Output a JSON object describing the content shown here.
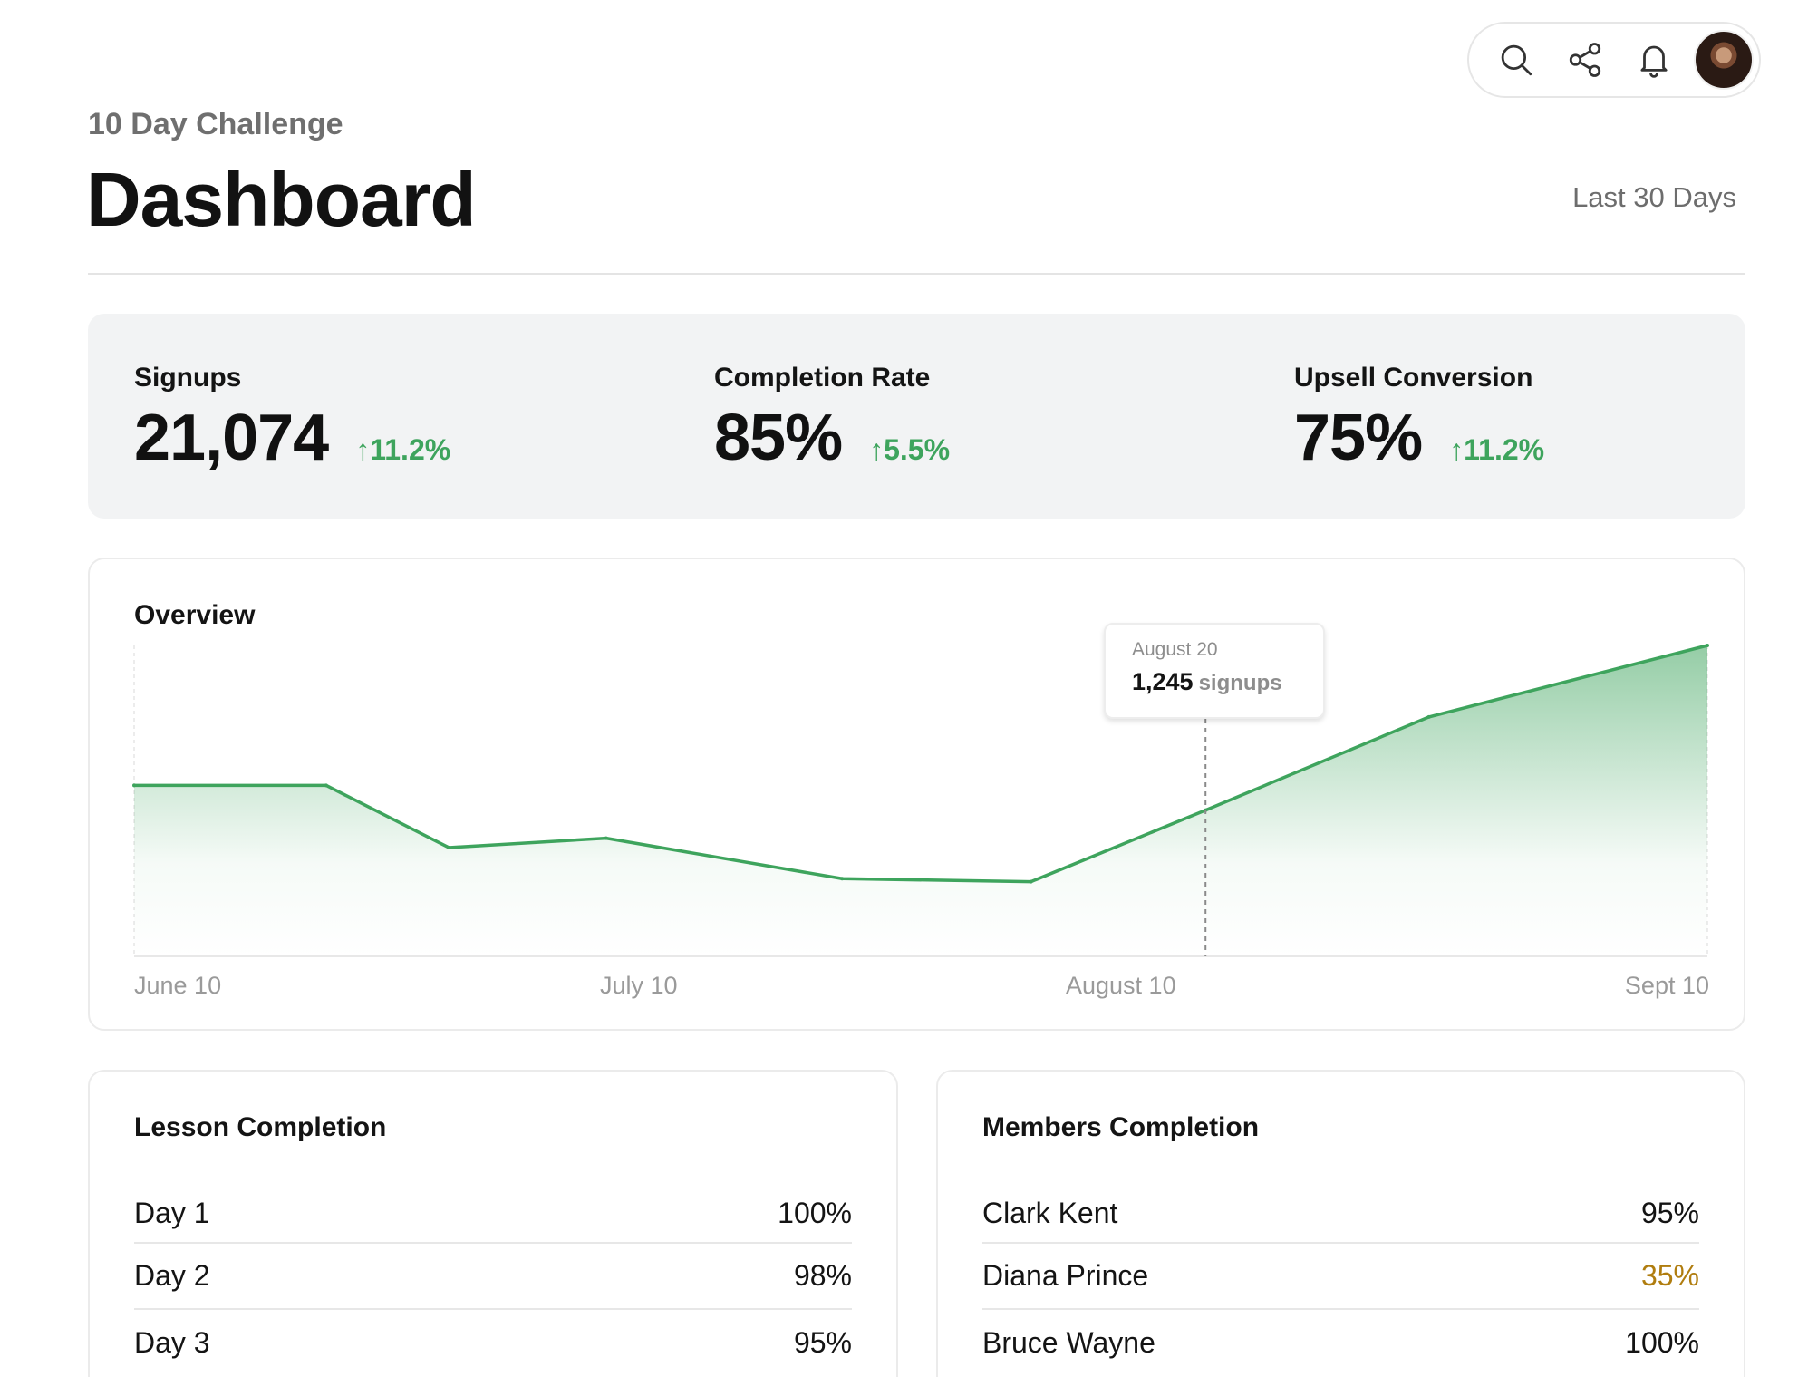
{
  "header": {
    "subtitle": "10 Day Challenge",
    "title": "Dashboard",
    "date_range": "Last 30 Days"
  },
  "toolbar": {
    "icons": [
      "search-icon",
      "share-icon",
      "bell-icon",
      "avatar"
    ]
  },
  "stats": [
    {
      "label": "Signups",
      "value": "21,074",
      "delta": "↑11.2%"
    },
    {
      "label": "Completion Rate",
      "value": "85%",
      "delta": "↑5.5%"
    },
    {
      "label": "Upsell Conversion",
      "value": "75%",
      "delta": "↑11.2%"
    }
  ],
  "overview": {
    "title": "Overview",
    "x_ticks": [
      "June 10",
      "July 10",
      "August 10",
      "Sept 10"
    ],
    "tooltip": {
      "date": "August 20",
      "value": "1,245",
      "unit": "signups"
    }
  },
  "lessons": {
    "title": "Lesson Completion",
    "rows": [
      {
        "name": "Day 1",
        "value": "100%"
      },
      {
        "name": "Day 2",
        "value": "98%"
      },
      {
        "name": "Day 3",
        "value": "95%"
      }
    ]
  },
  "members": {
    "title": "Members Completion",
    "rows": [
      {
        "name": "Clark Kent",
        "value": "95%"
      },
      {
        "name": "Diana Prince",
        "value": "35%"
      },
      {
        "name": "Bruce Wayne",
        "value": "100%"
      }
    ]
  },
  "colors": {
    "accent_green": "#3ea45d",
    "warning_gold": "#b07d0f"
  },
  "chart_data": {
    "type": "area",
    "x": [
      "June 10",
      "June 20",
      "June 30",
      "July 10",
      "July 31",
      "August 10",
      "August 20",
      "August 31",
      "Sept 10"
    ],
    "values": [
      0.55,
      0.55,
      0.35,
      0.38,
      0.25,
      0.24,
      0.47,
      0.77,
      1.0
    ],
    "tooltip_point": {
      "x": "August 20",
      "value": 1245
    },
    "grid": false
  }
}
